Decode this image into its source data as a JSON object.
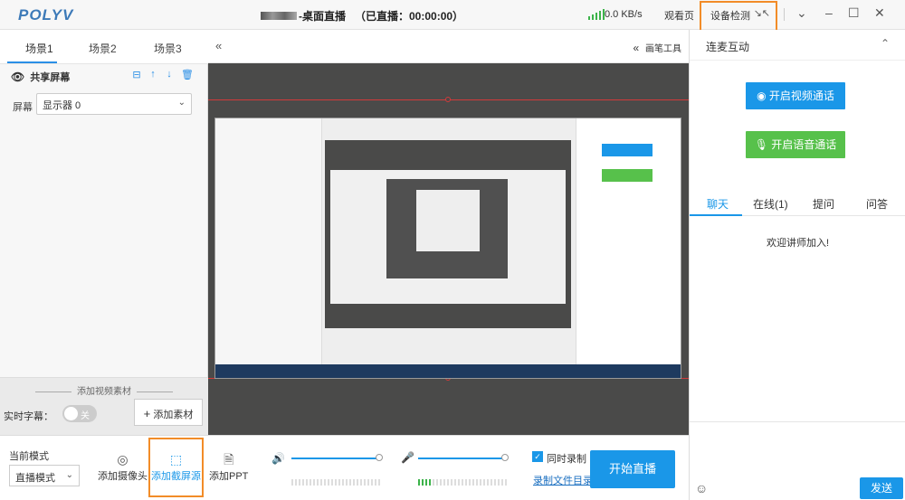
{
  "app": {
    "logo": "POLYV",
    "title": "-桌面直播",
    "live_status": "（已直播：00:00:00）",
    "speed": "0.0 KB/s",
    "viewer_page": "观看页",
    "device_check": "设备检测"
  },
  "scene_tabs": [
    "场景1",
    "场景2",
    "场景3"
  ],
  "source": {
    "name": "共享屏幕",
    "screen_label": "屏幕",
    "screen_value": "显示器 0"
  },
  "left_bottom": {
    "add_video_title": "添加视频素材",
    "subtitle_label": "实时字幕：",
    "toggle_text": "关",
    "add_material": "添加素材"
  },
  "preview": {
    "brush_tools": "画笔工具"
  },
  "right_panel": {
    "mic_title": "连麦互动",
    "video_call": "开启视频通话",
    "voice_call": "开启语音通话",
    "chat_tabs": [
      "聊天",
      "在线(1)",
      "提问",
      "问答"
    ],
    "welcome": "欢迎讲师加入!",
    "send": "发送"
  },
  "bottom": {
    "mode_label": "当前模式",
    "mode_value": "直播模式",
    "add_camera": "添加摄像头",
    "add_screen": "添加截屏源",
    "add_ppt": "添加PPT",
    "record_label": "同时录制",
    "record_dir": "录制文件目录",
    "start_live": "开始直播"
  },
  "colors": {
    "accent": "#1a97e8",
    "green": "#57c14b",
    "highlight": "#f28c28"
  }
}
